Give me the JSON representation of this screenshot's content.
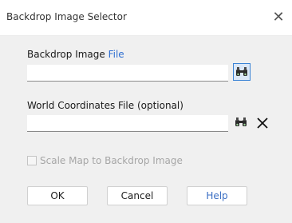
{
  "window": {
    "title": "Backdrop Image Selector",
    "close_icon": "close-icon"
  },
  "backdrop": {
    "label_prefix": "Backdrop Image ",
    "label_link": "File",
    "value": "",
    "browse_icon": "binoculars-icon"
  },
  "world": {
    "label": "World Coordinates File (optional)",
    "value": "",
    "browse_icon": "binoculars-icon",
    "clear_icon": "close-icon"
  },
  "scale_map": {
    "label": "Scale Map to Backdrop Image",
    "checked": false,
    "enabled": false
  },
  "buttons": {
    "ok": "OK",
    "cancel": "Cancel",
    "help": "Help"
  },
  "colors": {
    "link": "#2f6fd1",
    "help_text": "#3b6fc4",
    "disabled_text": "#a6a6a6",
    "dialog_bg": "#f0f0f0",
    "pressed_border": "#3a84d6"
  }
}
